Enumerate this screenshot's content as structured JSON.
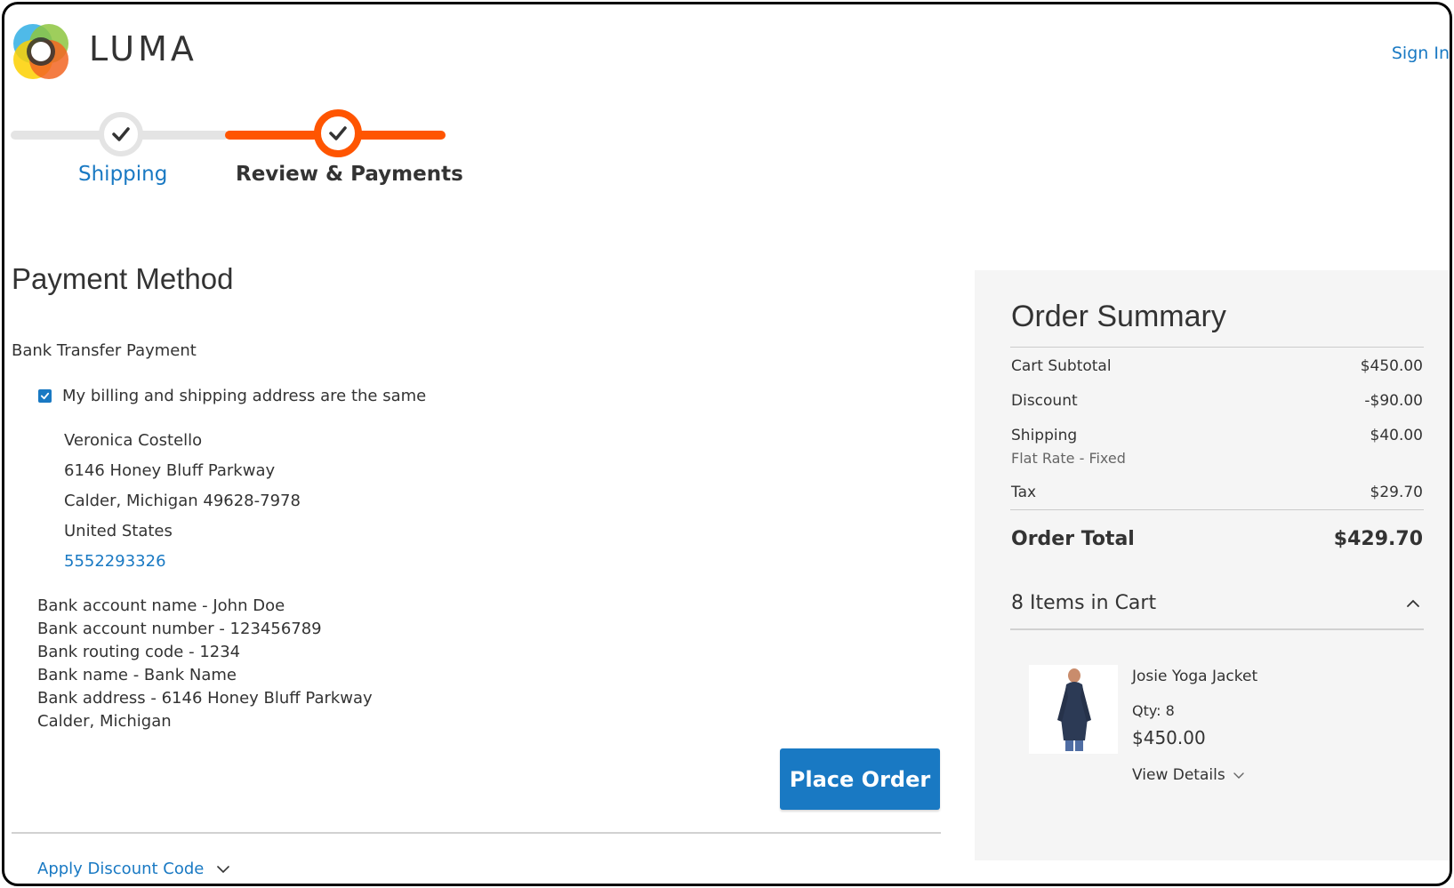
{
  "header": {
    "logo_text": "LUMA",
    "sign_in": "Sign In"
  },
  "progress": {
    "steps": [
      {
        "label": "Shipping",
        "completed": true,
        "active": false
      },
      {
        "label": "Review & Payments",
        "completed": false,
        "active": true
      }
    ]
  },
  "payment": {
    "title": "Payment Method",
    "method_name": "Bank Transfer Payment",
    "same_address_label": "My billing and shipping address are the same",
    "same_address_checked": true,
    "address": {
      "name": "Veronica Costello",
      "street": "6146 Honey Bluff Parkway",
      "city_state_zip": "Calder, Michigan 49628-7978",
      "country": "United States",
      "phone": "5552293326"
    },
    "bank_details": {
      "account_name": "Bank account name - John Doe",
      "account_number": "Bank account number - 123456789",
      "routing_code": "Bank routing code - 1234",
      "bank_name": "Bank name - Bank Name",
      "bank_address": "Bank address - 6146 Honey Bluff Parkway",
      "bank_city": "Calder, Michigan"
    },
    "place_order_label": "Place Order",
    "discount_label": "Apply Discount Code"
  },
  "summary": {
    "title": "Order Summary",
    "cart_subtotal_label": "Cart Subtotal",
    "cart_subtotal_value": "$450.00",
    "discount_label": "Discount",
    "discount_value": "-$90.00",
    "shipping_label": "Shipping",
    "shipping_method": "Flat Rate - Fixed",
    "shipping_value": "$40.00",
    "tax_label": "Tax",
    "tax_value": "$29.70",
    "order_total_label": "Order Total",
    "order_total_value": "$429.70",
    "items_in_cart": "8 Items in Cart",
    "product": {
      "name": "Josie Yoga Jacket",
      "qty": "Qty: 8",
      "price": "$450.00",
      "view_details": "View Details"
    }
  },
  "colors": {
    "accent": "#1979c3",
    "progress_active": "#ff5501",
    "progress_inactive": "#e4e4e4",
    "summary_bg": "#f5f5f5"
  },
  "icons": {
    "logo": "luma-logo-icon",
    "step_check": "check-icon",
    "checkbox": "checkbox-checked-icon",
    "discount_toggle": "chevron-down-icon",
    "cart_toggle": "chevron-up-icon",
    "view_details_toggle": "chevron-down-icon"
  }
}
